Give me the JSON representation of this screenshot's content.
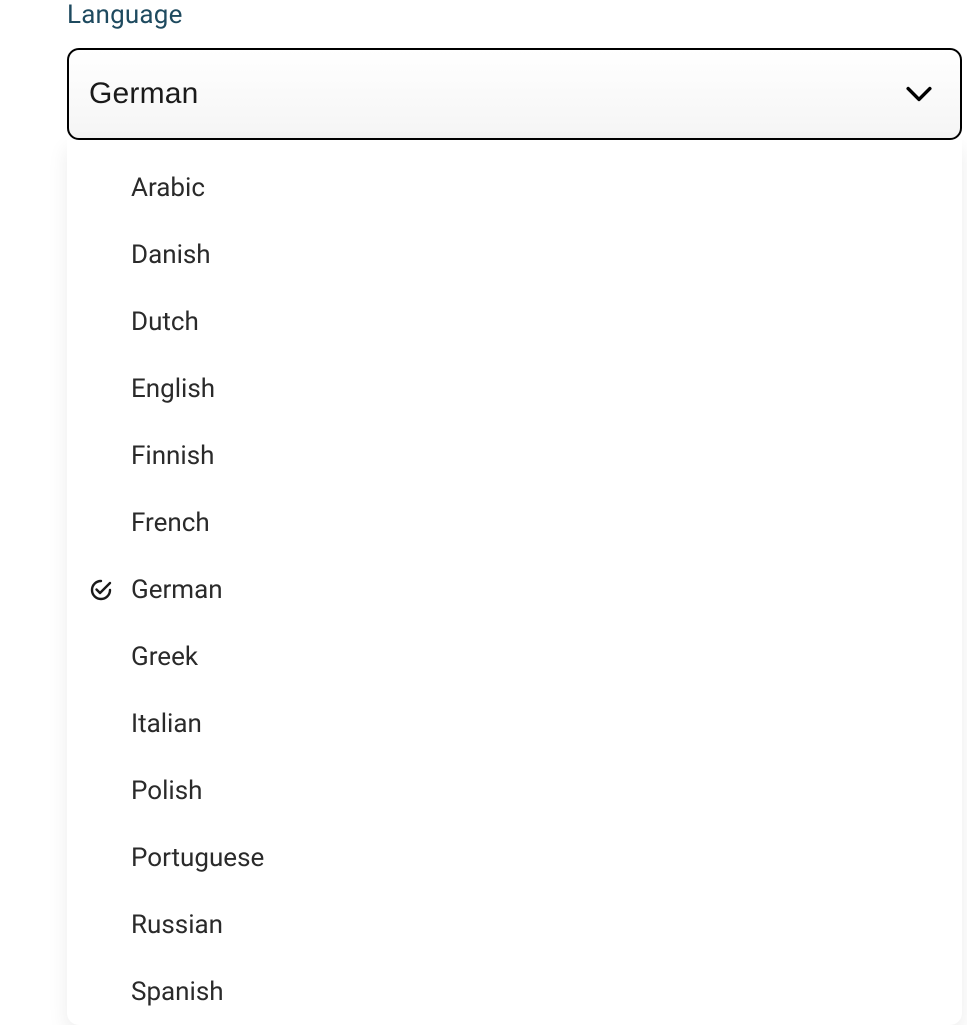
{
  "language_select": {
    "label": "Language",
    "selected": "German",
    "options": [
      {
        "label": "Arabic",
        "selected": false
      },
      {
        "label": "Danish",
        "selected": false
      },
      {
        "label": "Dutch",
        "selected": false
      },
      {
        "label": "English",
        "selected": false
      },
      {
        "label": "Finnish",
        "selected": false
      },
      {
        "label": "French",
        "selected": false
      },
      {
        "label": "German",
        "selected": true
      },
      {
        "label": "Greek",
        "selected": false
      },
      {
        "label": "Italian",
        "selected": false
      },
      {
        "label": "Polish",
        "selected": false
      },
      {
        "label": "Portuguese",
        "selected": false
      },
      {
        "label": "Russian",
        "selected": false
      },
      {
        "label": "Spanish",
        "selected": false
      }
    ]
  }
}
